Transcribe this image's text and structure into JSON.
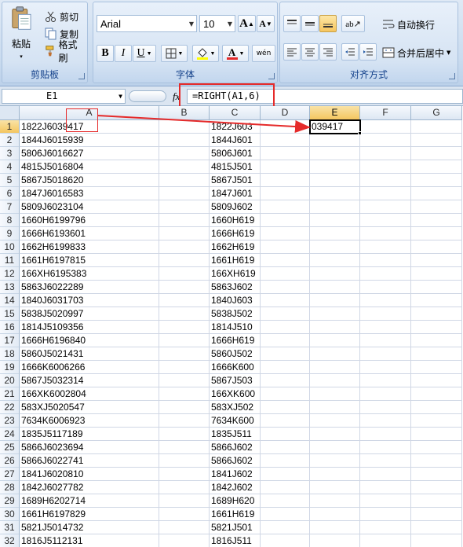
{
  "ribbon": {
    "clipboard": {
      "paste": "粘贴",
      "cut": "剪切",
      "copy": "复制",
      "format_painter": "格式刷",
      "label": "剪贴板"
    },
    "font": {
      "name": "Arial",
      "size": "10",
      "label": "字体",
      "bold": "B",
      "italic": "I",
      "underline": "U",
      "font_color_glyph": "A",
      "grow_glyph": "A",
      "shrink_glyph": "A",
      "phonetic_glyph": "wén"
    },
    "alignment": {
      "wrap_text": "自动换行",
      "merge_center": "合并后居中",
      "label": "对齐方式"
    }
  },
  "formula_bar": {
    "name_box": "E1",
    "fx": "fx",
    "formula": "=RIGHT(A1,6)"
  },
  "columns": [
    "A",
    "B",
    "C",
    "D",
    "E",
    "F",
    "G"
  ],
  "selected_column": "E",
  "selected_row": 1,
  "rows": [
    {
      "n": "1",
      "a": "1822J6039417",
      "c": "1822J603",
      "e": "039417"
    },
    {
      "n": "2",
      "a": "1844J6015939",
      "c": "1844J601"
    },
    {
      "n": "3",
      "a": "5806J6016627",
      "c": "5806J601"
    },
    {
      "n": "4",
      "a": "4815J5016804",
      "c": "4815J501"
    },
    {
      "n": "5",
      "a": "5867J5018620",
      "c": "5867J501"
    },
    {
      "n": "6",
      "a": "1847J6016583",
      "c": "1847J601"
    },
    {
      "n": "7",
      "a": "5809J6023104",
      "c": "5809J602"
    },
    {
      "n": "8",
      "a": "1660H6199796",
      "c": "1660H619"
    },
    {
      "n": "9",
      "a": "1666H6193601",
      "c": "1666H619"
    },
    {
      "n": "10",
      "a": "1662H6199833",
      "c": "1662H619"
    },
    {
      "n": "11",
      "a": "1661H6197815",
      "c": "1661H619"
    },
    {
      "n": "12",
      "a": "166XH6195383",
      "c": "166XH619"
    },
    {
      "n": "13",
      "a": "5863J6022289",
      "c": "5863J602"
    },
    {
      "n": "14",
      "a": "1840J6031703",
      "c": "1840J603"
    },
    {
      "n": "15",
      "a": "5838J5020997",
      "c": "5838J502"
    },
    {
      "n": "16",
      "a": "1814J5109356",
      "c": "1814J510"
    },
    {
      "n": "17",
      "a": "1666H6196840",
      "c": "1666H619"
    },
    {
      "n": "18",
      "a": "5860J5021431",
      "c": "5860J502"
    },
    {
      "n": "19",
      "a": "1666K6006266",
      "c": "1666K600"
    },
    {
      "n": "20",
      "a": "5867J5032314",
      "c": "5867J503"
    },
    {
      "n": "21",
      "a": "166XK6002804",
      "c": "166XK600"
    },
    {
      "n": "22",
      "a": "583XJ5020547",
      "c": "583XJ502"
    },
    {
      "n": "23",
      "a": "7634K6006923",
      "c": "7634K600"
    },
    {
      "n": "24",
      "a": "1835J5117189",
      "c": "1835J511"
    },
    {
      "n": "25",
      "a": "5866J6023694",
      "c": "5866J602"
    },
    {
      "n": "26",
      "a": "5866J6022741",
      "c": "5866J602"
    },
    {
      "n": "27",
      "a": "1841J6020810",
      "c": "1841J602"
    },
    {
      "n": "28",
      "a": "1842J6027782",
      "c": "1842J602"
    },
    {
      "n": "29",
      "a": "1689H6202714",
      "c": "1689H620"
    },
    {
      "n": "30",
      "a": "1661H6197829",
      "c": "1661H619"
    },
    {
      "n": "31",
      "a": "5821J5014732",
      "c": "5821J501"
    },
    {
      "n": "32",
      "a": "1816J5112131",
      "c": "1816J511"
    }
  ],
  "colors": {
    "annotation": "#e52a2a",
    "selection": "#f4c65f"
  }
}
